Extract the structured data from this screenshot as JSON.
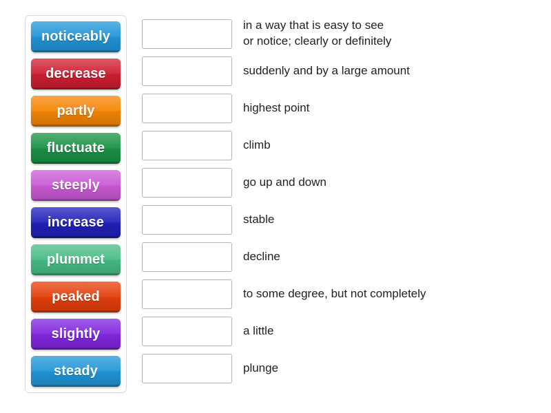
{
  "activity": {
    "type": "match-up",
    "tile_panel": {
      "name": "word-tiles",
      "tiles": [
        {
          "label": "noticeably",
          "color": "#2196d8"
        },
        {
          "label": "decrease",
          "color": "#cf1f32"
        },
        {
          "label": "partly",
          "color": "#f58505"
        },
        {
          "label": "fluctuate",
          "color": "#1a9245"
        },
        {
          "label": "steeply",
          "color": "#cb5ad6"
        },
        {
          "label": "increase",
          "color": "#2020ba"
        },
        {
          "label": "plummet",
          "color": "#47bd85"
        },
        {
          "label": "peaked",
          "color": "#e53f0c"
        },
        {
          "label": "slightly",
          "color": "#8126e0"
        },
        {
          "label": "steady",
          "color": "#2196d8"
        }
      ]
    },
    "rows": [
      {
        "drop_value": "",
        "definition": "in a way that is easy to see\nor notice; clearly or definitely"
      },
      {
        "drop_value": "",
        "definition": "suddenly and by a large amount"
      },
      {
        "drop_value": "",
        "definition": "highest point"
      },
      {
        "drop_value": "",
        "definition": "climb"
      },
      {
        "drop_value": "",
        "definition": "go up and down"
      },
      {
        "drop_value": "",
        "definition": "stable"
      },
      {
        "drop_value": "",
        "definition": "decline"
      },
      {
        "drop_value": "",
        "definition": "to some degree, but not completely"
      },
      {
        "drop_value": "",
        "definition": "a little"
      },
      {
        "drop_value": "",
        "definition": "plunge"
      }
    ]
  }
}
